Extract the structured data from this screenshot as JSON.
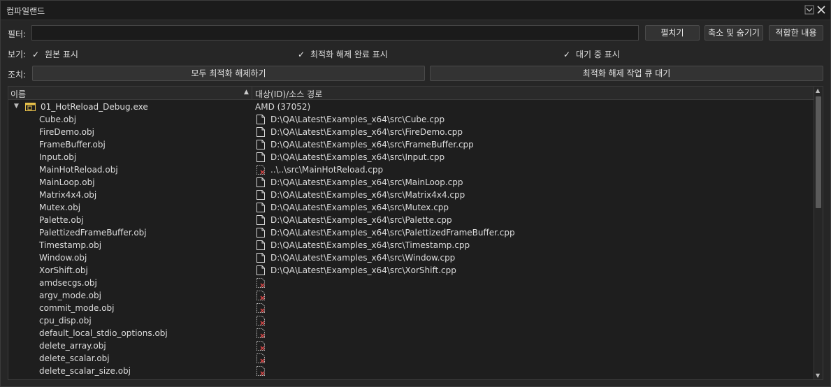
{
  "window": {
    "title": "컴파일랜드",
    "icons": [
      "minimize-icon",
      "close-icon"
    ]
  },
  "filter": {
    "label": "필터:",
    "value": "",
    "placeholder": "",
    "expand_label": "펼치기",
    "collapse_label": "축소 및 숨기기",
    "fit_label": "적합한 내용"
  },
  "view": {
    "label": "보기:",
    "options": [
      {
        "label": "원본 표시",
        "checked": true
      },
      {
        "label": "최적화 해제 완료 표시",
        "checked": true
      },
      {
        "label": "대기 중 표시",
        "checked": true
      }
    ]
  },
  "action": {
    "label": "조치:",
    "deopt_all_label": "모두 최적화 해제하기",
    "queue_label": "최적화 해제 작업 큐 대기"
  },
  "grid": {
    "columns": [
      "이름",
      "대상(ID)/소스 경로"
    ],
    "root": {
      "name": "01_HotReload_Debug.exe",
      "target": "AMD (37052)"
    },
    "items": [
      {
        "name": "Cube.obj",
        "path": "D:\\QA\\Latest\\Examples_x64\\src\\Cube.cpp",
        "icon": "file-icon"
      },
      {
        "name": "FireDemo.obj",
        "path": "D:\\QA\\Latest\\Examples_x64\\src\\FireDemo.cpp",
        "icon": "file-icon"
      },
      {
        "name": "FrameBuffer.obj",
        "path": "D:\\QA\\Latest\\Examples_x64\\src\\FrameBuffer.cpp",
        "icon": "file-icon"
      },
      {
        "name": "Input.obj",
        "path": "D:\\QA\\Latest\\Examples_x64\\src\\Input.cpp",
        "icon": "file-icon"
      },
      {
        "name": "MainHotReload.obj",
        "path": "..\\..\\src\\MainHotReload.cpp",
        "icon": "missing-file-icon"
      },
      {
        "name": "MainLoop.obj",
        "path": "D:\\QA\\Latest\\Examples_x64\\src\\MainLoop.cpp",
        "icon": "file-icon"
      },
      {
        "name": "Matrix4x4.obj",
        "path": "D:\\QA\\Latest\\Examples_x64\\src\\Matrix4x4.cpp",
        "icon": "file-icon"
      },
      {
        "name": "Mutex.obj",
        "path": "D:\\QA\\Latest\\Examples_x64\\src\\Mutex.cpp",
        "icon": "file-icon"
      },
      {
        "name": "Palette.obj",
        "path": "D:\\QA\\Latest\\Examples_x64\\src\\Palette.cpp",
        "icon": "file-icon"
      },
      {
        "name": "PalettizedFrameBuffer.obj",
        "path": "D:\\QA\\Latest\\Examples_x64\\src\\PalettizedFrameBuffer.cpp",
        "icon": "file-icon"
      },
      {
        "name": "Timestamp.obj",
        "path": "D:\\QA\\Latest\\Examples_x64\\src\\Timestamp.cpp",
        "icon": "file-icon"
      },
      {
        "name": "Window.obj",
        "path": "D:\\QA\\Latest\\Examples_x64\\src\\Window.cpp",
        "icon": "file-icon"
      },
      {
        "name": "XorShift.obj",
        "path": "D:\\QA\\Latest\\Examples_x64\\src\\XorShift.cpp",
        "icon": "file-icon"
      },
      {
        "name": "amdsecgs.obj",
        "path": "",
        "icon": "missing-file-icon"
      },
      {
        "name": "argv_mode.obj",
        "path": "",
        "icon": "missing-file-icon"
      },
      {
        "name": "commit_mode.obj",
        "path": "",
        "icon": "missing-file-icon"
      },
      {
        "name": "cpu_disp.obj",
        "path": "",
        "icon": "missing-file-icon"
      },
      {
        "name": "default_local_stdio_options.obj",
        "path": "",
        "icon": "missing-file-icon"
      },
      {
        "name": "delete_array.obj",
        "path": "",
        "icon": "missing-file-icon"
      },
      {
        "name": "delete_scalar.obj",
        "path": "",
        "icon": "missing-file-icon"
      },
      {
        "name": "delete_scalar_size.obj",
        "path": "",
        "icon": "missing-file-icon"
      }
    ]
  },
  "colors": {
    "background": "#262626",
    "grid_background": "#1e1e1e",
    "exe_icon": "#e8c14a",
    "missing_mark": "#e04848"
  }
}
